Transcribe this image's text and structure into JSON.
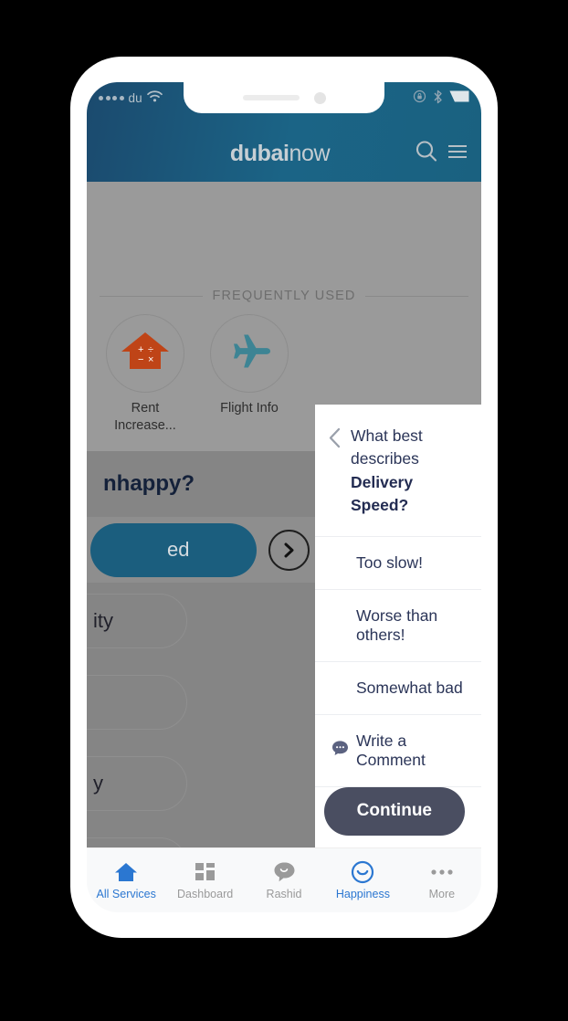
{
  "status_bar": {
    "carrier": "du",
    "signal_dots": 4,
    "icons": [
      "wifi-icon",
      "rotation-lock-icon",
      "bluetooth-icon",
      "battery-icon"
    ]
  },
  "header": {
    "logo_bold": "dubai",
    "logo_light": "now",
    "actions": [
      "search-icon",
      "hamburger-menu-icon"
    ]
  },
  "frequently_used": {
    "section_title": "FREQUENTLY USED",
    "tiles": [
      {
        "label": "Rent Increase...",
        "icon": "house-calculator-icon",
        "color": "#bf4417"
      },
      {
        "label": "Flight Info",
        "icon": "airplane-icon",
        "color": "#3d8494"
      }
    ]
  },
  "background_survey": {
    "title": "nhappy?",
    "selected_option": "ed",
    "next_icon": "chevron-right-circle-icon",
    "options": [
      "ity",
      "",
      "y"
    ]
  },
  "survey_panel": {
    "back_icon": "chevron-left-icon",
    "question_line1": "What best describes",
    "question_line2": "Delivery Speed?",
    "options": [
      {
        "label": "Too slow!",
        "icon": null
      },
      {
        "label": "Worse than others!",
        "icon": null
      },
      {
        "label": "Somewhat bad",
        "icon": null
      },
      {
        "label": "Write a Comment",
        "icon": "comment-bubble-icon"
      }
    ],
    "continue_label": "Continue",
    "continue_color": "#4a4e61"
  },
  "bottom_nav": {
    "items": [
      {
        "label": "All Services",
        "icon": "home-icon",
        "active": true
      },
      {
        "label": "Dashboard",
        "icon": "dashboard-grid-icon",
        "active": false
      },
      {
        "label": "Rashid",
        "icon": "chat-bubble-icon",
        "active": false
      },
      {
        "label": "Happiness",
        "icon": "smiley-face-icon",
        "active": true
      },
      {
        "label": "More",
        "icon": "ellipsis-icon",
        "active": false
      }
    ],
    "active_color": "#2b77d1",
    "inactive_color": "#9a9a9a"
  }
}
